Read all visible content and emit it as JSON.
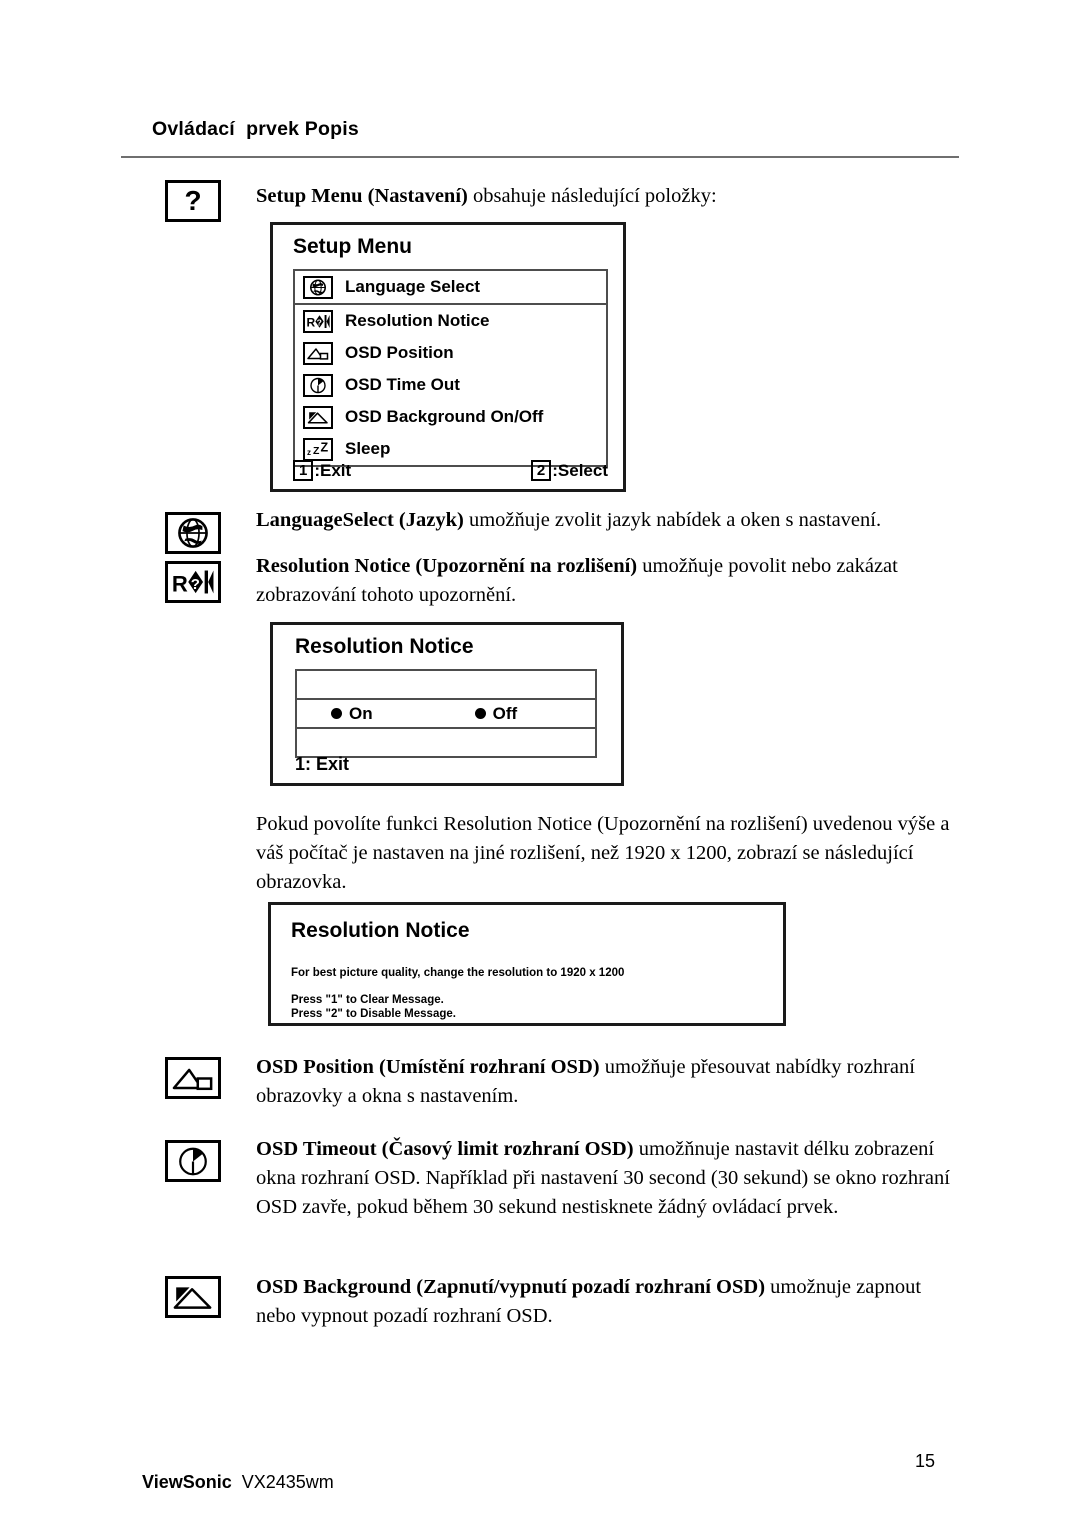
{
  "header": {
    "title": "Ovládací  prvek Popis"
  },
  "intro": {
    "bold": "Setup Menu  (Nastavení)",
    "rest": " obsahuje následující položky:",
    "icon": "question-mark-icon",
    "icon_glyph": "?"
  },
  "setup_menu": {
    "heading": "Setup Menu",
    "items": [
      {
        "label": "Language Select",
        "icon": "globe-icon"
      },
      {
        "label": "Resolution Notice",
        "icon": "resolution-icon"
      },
      {
        "label": "OSD Position",
        "icon": "osd-position-icon"
      },
      {
        "label": "OSD Time Out",
        "icon": "clock-icon"
      },
      {
        "label": "OSD Background On/Off",
        "icon": "mountain-icon"
      },
      {
        "label": "Sleep",
        "icon": "sleep-zzz-icon"
      }
    ],
    "footer": {
      "exit_key": "1",
      "exit_label": ":Exit",
      "select_key": "2",
      "select_label": ":Select"
    }
  },
  "language_select_para": {
    "bold": "LanguageSelect  (Jazyk)",
    "rest": " umožňuje zvolit jazyk nabídek a oken s nastavení.",
    "icon": "globe-icon"
  },
  "resolution_notice_para": {
    "bold": "Resolution Notice (Upozornění na rozlišení)",
    "rest": " umožňuje povolit nebo zakázat zobrazování tohoto upozornění.",
    "icon": "resolution-icon"
  },
  "resolution_notice_dialog": {
    "heading": "Resolution Notice",
    "option_on": "On",
    "option_off": "Off",
    "exit": "1: Exit"
  },
  "resolution_body_para": {
    "text": "Pokud povolíte funkci Resolution Notice (Upozornění na rozlišení) uvedenou výše a váš počítač je nastaven na jiné rozlišení, než 1920 x 1200, zobrazí se následující obrazovka."
  },
  "resolution_message_dialog": {
    "heading": "Resolution Notice",
    "line1": "For best picture quality, change the resolution to 1920 x 1200",
    "line2": "Press \"1\" to Clear Message.",
    "line3": "Press \"2\" to Disable Message."
  },
  "osd_position_para": {
    "bold": "OSD Position (Umístění rozhraní OSD)",
    "rest": " umožňuje přesouvat nabídky rozhraní obrazovky a okna s nastavením.",
    "icon": "osd-position-icon"
  },
  "osd_timeout_para": {
    "bold": "OSD Timeout (Časový limit rozhraní OSD)",
    "rest": " umožňnuje nastavit délku zobrazení okna rozhraní OSD. Například při nastavení 30 second (30 sekund) se okno rozhraní OSD zavře, pokud během 30 sekund nestisknete žádný ovládací prvek.",
    "icon": "clock-icon"
  },
  "osd_background_para": {
    "bold": "OSD Background (Zapnutí/vypnutí pozadí rozhraní OSD)",
    "rest": " umožnuje zapnout nebo vypnout pozadí rozhraní OSD.",
    "icon": "mountain-icon"
  },
  "footer": {
    "brand": "ViewSonic",
    "model": "  VX2435wm",
    "page_number": "15"
  },
  "colors": {
    "text": "#000000",
    "rule": "#6f6f6f",
    "box_border": "#1a1a1a",
    "inner_border": "#4d4d4d"
  }
}
